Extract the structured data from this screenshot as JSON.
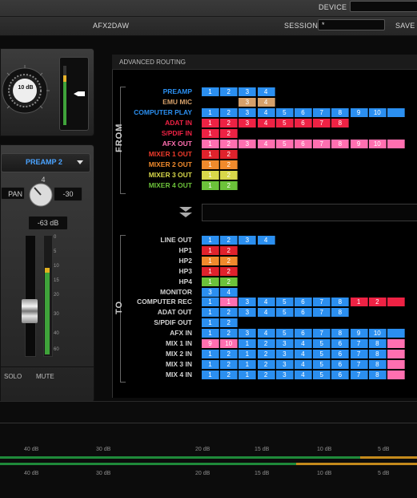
{
  "topbar": {
    "device_label": "DEVICE",
    "device_value": "",
    "tab_label": "AFX2DAW",
    "session_label": "SESSION:",
    "session_value": "*",
    "save_label": "SAVE"
  },
  "preamp_panel": {
    "knob_value": "10 dB"
  },
  "channel_strip": {
    "source": "PREAMP 2",
    "number": "4",
    "pan_label": "PAN",
    "pan_value": "-30",
    "level": "-63 dB",
    "solo_label": "SOLO",
    "mute_label": "MUTE",
    "scale": [
      "0",
      "5",
      "10",
      "15",
      "20",
      "30",
      "40",
      "60"
    ]
  },
  "routing": {
    "title": "ADVANCED ROUTING",
    "from_label": "FROM",
    "to_label": "TO",
    "colors": {
      "blue": "#2b8ff0",
      "tan": "#d6a06a",
      "red": "#ee2244",
      "pink": "#ff6fb0",
      "orange": "#f08a2c",
      "yellow": "#d8d84a",
      "green": "#6cc23a",
      "deepred": "#e0222c"
    },
    "from_rows": [
      {
        "label": "PREAMP",
        "color": "#2b8ff0",
        "cells": [
          {
            "t": "1",
            "c": "blue"
          },
          {
            "t": "2",
            "c": "blue"
          },
          {
            "t": "3",
            "c": "blue"
          },
          {
            "t": "4",
            "c": "blue"
          }
        ]
      },
      {
        "label": "EMU MIC",
        "color": "#d6a06a",
        "cells": [
          {
            "t": "",
            "c": "none"
          },
          {
            "t": "",
            "c": "none"
          },
          {
            "t": "3",
            "c": "tan"
          },
          {
            "t": "4",
            "c": "tan"
          }
        ]
      },
      {
        "label": "COMPUTER PLAY",
        "color": "#2b8ff0",
        "cells": [
          {
            "t": "1",
            "c": "blue"
          },
          {
            "t": "2",
            "c": "blue"
          },
          {
            "t": "3",
            "c": "blue"
          },
          {
            "t": "4",
            "c": "blue"
          },
          {
            "t": "5",
            "c": "blue"
          },
          {
            "t": "6",
            "c": "blue"
          },
          {
            "t": "7",
            "c": "blue"
          },
          {
            "t": "8",
            "c": "blue"
          },
          {
            "t": "9",
            "c": "blue"
          },
          {
            "t": "10",
            "c": "blue"
          },
          {
            "t": "",
            "c": "blue"
          }
        ]
      },
      {
        "label": "ADAT IN",
        "color": "#ee2244",
        "cells": [
          {
            "t": "1",
            "c": "red"
          },
          {
            "t": "2",
            "c": "red"
          },
          {
            "t": "3",
            "c": "red"
          },
          {
            "t": "4",
            "c": "red"
          },
          {
            "t": "5",
            "c": "red"
          },
          {
            "t": "6",
            "c": "red"
          },
          {
            "t": "7",
            "c": "red"
          },
          {
            "t": "8",
            "c": "red"
          }
        ]
      },
      {
        "label": "S/PDIF IN",
        "color": "#ee2244",
        "cells": [
          {
            "t": "1",
            "c": "red"
          },
          {
            "t": "2",
            "c": "red"
          }
        ]
      },
      {
        "label": "AFX OUT",
        "color": "#ff6fb0",
        "cells": [
          {
            "t": "1",
            "c": "pink"
          },
          {
            "t": "2",
            "c": "pink"
          },
          {
            "t": "3",
            "c": "pink"
          },
          {
            "t": "4",
            "c": "pink"
          },
          {
            "t": "5",
            "c": "pink"
          },
          {
            "t": "6",
            "c": "pink"
          },
          {
            "t": "7",
            "c": "pink"
          },
          {
            "t": "8",
            "c": "pink"
          },
          {
            "t": "9",
            "c": "pink"
          },
          {
            "t": "10",
            "c": "pink"
          },
          {
            "t": "",
            "c": "pink"
          }
        ]
      },
      {
        "label": "MIXER 1 OUT",
        "color": "#ee3b2b",
        "cells": [
          {
            "t": "1",
            "c": "deepred"
          },
          {
            "t": "2",
            "c": "deepred"
          }
        ]
      },
      {
        "label": "MIXER 2 OUT",
        "color": "#f08a2c",
        "cells": [
          {
            "t": "1",
            "c": "orange"
          },
          {
            "t": "2",
            "c": "orange"
          }
        ]
      },
      {
        "label": "MIXER 3 OUT",
        "color": "#d8d84a",
        "cells": [
          {
            "t": "1",
            "c": "yellow"
          },
          {
            "t": "2",
            "c": "yellow"
          }
        ]
      },
      {
        "label": "MIXER 4 OUT",
        "color": "#6cc23a",
        "cells": [
          {
            "t": "1",
            "c": "green"
          },
          {
            "t": "2",
            "c": "green"
          }
        ]
      }
    ],
    "to_rows": [
      {
        "label": "LINE OUT",
        "cells": [
          {
            "t": "1",
            "c": "blue"
          },
          {
            "t": "2",
            "c": "blue"
          },
          {
            "t": "3",
            "c": "blue"
          },
          {
            "t": "4",
            "c": "blue"
          }
        ]
      },
      {
        "label": "HP1",
        "cells": [
          {
            "t": "1",
            "c": "deepred"
          },
          {
            "t": "2",
            "c": "deepred"
          }
        ]
      },
      {
        "label": "HP2",
        "cells": [
          {
            "t": "1",
            "c": "orange"
          },
          {
            "t": "2",
            "c": "orange"
          }
        ]
      },
      {
        "label": "HP3",
        "cells": [
          {
            "t": "1",
            "c": "deepred"
          },
          {
            "t": "2",
            "c": "deepred"
          }
        ]
      },
      {
        "label": "HP4",
        "cells": [
          {
            "t": "1",
            "c": "green"
          },
          {
            "t": "2",
            "c": "green"
          }
        ]
      },
      {
        "label": "MONITOR",
        "cells": [
          {
            "t": "3",
            "c": "blue"
          },
          {
            "t": "4",
            "c": "blue"
          }
        ]
      },
      {
        "label": "COMPUTER REC",
        "cells": [
          {
            "t": "1",
            "c": "blue"
          },
          {
            "t": "1",
            "c": "pink"
          },
          {
            "t": "3",
            "c": "blue"
          },
          {
            "t": "4",
            "c": "blue"
          },
          {
            "t": "5",
            "c": "blue"
          },
          {
            "t": "6",
            "c": "blue"
          },
          {
            "t": "7",
            "c": "blue"
          },
          {
            "t": "8",
            "c": "blue"
          },
          {
            "t": "1",
            "c": "red"
          },
          {
            "t": "2",
            "c": "red"
          },
          {
            "t": "",
            "c": "red"
          }
        ]
      },
      {
        "label": "ADAT OUT",
        "cells": [
          {
            "t": "1",
            "c": "blue"
          },
          {
            "t": "2",
            "c": "blue"
          },
          {
            "t": "3",
            "c": "blue"
          },
          {
            "t": "4",
            "c": "blue"
          },
          {
            "t": "5",
            "c": "blue"
          },
          {
            "t": "6",
            "c": "blue"
          },
          {
            "t": "7",
            "c": "blue"
          },
          {
            "t": "8",
            "c": "blue"
          }
        ]
      },
      {
        "label": "S/PDIF OUT",
        "cells": [
          {
            "t": "1",
            "c": "blue"
          },
          {
            "t": "2",
            "c": "blue"
          }
        ]
      },
      {
        "label": "AFX IN",
        "cells": [
          {
            "t": "1",
            "c": "blue"
          },
          {
            "t": "2",
            "c": "blue"
          },
          {
            "t": "3",
            "c": "blue"
          },
          {
            "t": "4",
            "c": "blue"
          },
          {
            "t": "5",
            "c": "blue"
          },
          {
            "t": "6",
            "c": "blue"
          },
          {
            "t": "7",
            "c": "blue"
          },
          {
            "t": "8",
            "c": "blue"
          },
          {
            "t": "9",
            "c": "blue"
          },
          {
            "t": "10",
            "c": "blue"
          },
          {
            "t": "",
            "c": "blue"
          }
        ]
      },
      {
        "label": "MIX 1 IN",
        "cells": [
          {
            "t": "9",
            "c": "pink"
          },
          {
            "t": "10",
            "c": "pink"
          },
          {
            "t": "1",
            "c": "blue"
          },
          {
            "t": "2",
            "c": "blue"
          },
          {
            "t": "3",
            "c": "blue"
          },
          {
            "t": "4",
            "c": "blue"
          },
          {
            "t": "5",
            "c": "blue"
          },
          {
            "t": "6",
            "c": "blue"
          },
          {
            "t": "7",
            "c": "blue"
          },
          {
            "t": "8",
            "c": "blue"
          },
          {
            "t": "",
            "c": "pink"
          }
        ]
      },
      {
        "label": "MIX 2 IN",
        "cells": [
          {
            "t": "1",
            "c": "blue"
          },
          {
            "t": "2",
            "c": "blue"
          },
          {
            "t": "1",
            "c": "blue"
          },
          {
            "t": "2",
            "c": "blue"
          },
          {
            "t": "3",
            "c": "blue"
          },
          {
            "t": "4",
            "c": "blue"
          },
          {
            "t": "5",
            "c": "blue"
          },
          {
            "t": "6",
            "c": "blue"
          },
          {
            "t": "7",
            "c": "blue"
          },
          {
            "t": "8",
            "c": "blue"
          },
          {
            "t": "",
            "c": "pink"
          }
        ]
      },
      {
        "label": "MIX 3 IN",
        "cells": [
          {
            "t": "1",
            "c": "blue"
          },
          {
            "t": "2",
            "c": "blue"
          },
          {
            "t": "1",
            "c": "blue"
          },
          {
            "t": "2",
            "c": "blue"
          },
          {
            "t": "3",
            "c": "blue"
          },
          {
            "t": "4",
            "c": "blue"
          },
          {
            "t": "5",
            "c": "blue"
          },
          {
            "t": "6",
            "c": "blue"
          },
          {
            "t": "7",
            "c": "blue"
          },
          {
            "t": "8",
            "c": "blue"
          },
          {
            "t": "",
            "c": "pink"
          }
        ]
      },
      {
        "label": "MIX 4 IN",
        "cells": [
          {
            "t": "1",
            "c": "blue"
          },
          {
            "t": "2",
            "c": "blue"
          },
          {
            "t": "1",
            "c": "blue"
          },
          {
            "t": "2",
            "c": "blue"
          },
          {
            "t": "3",
            "c": "blue"
          },
          {
            "t": "4",
            "c": "blue"
          },
          {
            "t": "5",
            "c": "blue"
          },
          {
            "t": "6",
            "c": "blue"
          },
          {
            "t": "7",
            "c": "blue"
          },
          {
            "t": "8",
            "c": "blue"
          },
          {
            "t": "",
            "c": "pink"
          }
        ]
      }
    ]
  },
  "meter_bar": {
    "ticks": [
      "40 dB",
      "30 dB",
      "20 dB",
      "15 dB",
      "10 dB",
      "5 dB"
    ]
  }
}
